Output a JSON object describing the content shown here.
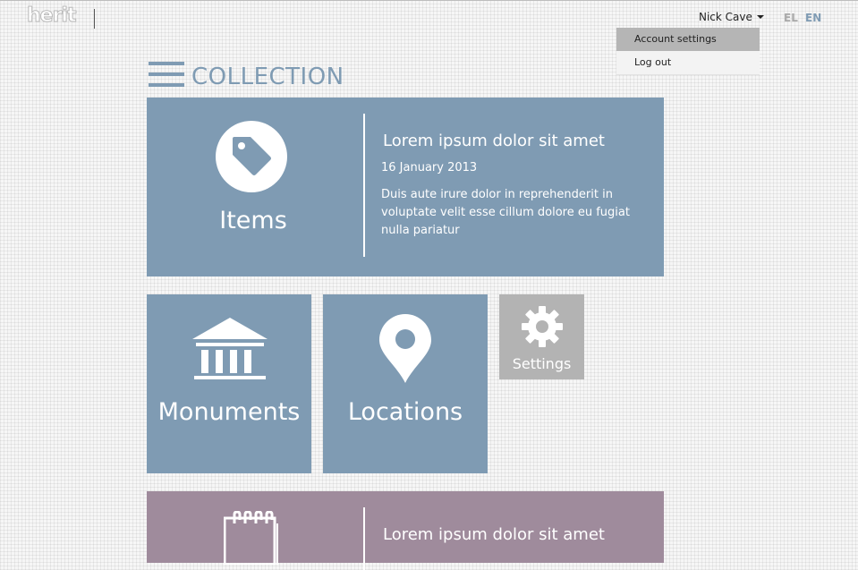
{
  "header": {
    "logo_text": "herit",
    "user_name": "Nick Cave",
    "languages": [
      "EL",
      "EN"
    ],
    "active_language": "EN",
    "colors": {
      "accent": "#7f9bb3",
      "inactive_lang": "#a9a9a9"
    }
  },
  "dropdown": {
    "items": [
      {
        "label": "Account settings",
        "active": true
      },
      {
        "label": "Log out",
        "active": false
      }
    ]
  },
  "section": {
    "title": "COLLECTION",
    "icon": "hamburger-menu-icon"
  },
  "tiles": {
    "items": {
      "label": "Items",
      "icon": "tag-icon",
      "news": {
        "title": "Lorem ipsum dolor sit amet",
        "date": "16 January 2013",
        "body": "Duis aute irure dolor in reprehenderit in voluptate velit esse cillum dolore eu fugiat nulla pariatur"
      },
      "color": "#7f9bb3"
    },
    "monuments": {
      "label": "Monuments",
      "icon": "temple-icon",
      "color": "#7f9bb3"
    },
    "locations": {
      "label": "Locations",
      "icon": "map-pin-icon",
      "color": "#7f9bb3"
    },
    "settings": {
      "label": "Settings",
      "icon": "gear-icon",
      "color": "#b3b3b3"
    },
    "notes": {
      "icon": "notepad-icon",
      "news": {
        "title": "Lorem ipsum dolor sit amet"
      },
      "color": "#9f8b9c"
    }
  }
}
